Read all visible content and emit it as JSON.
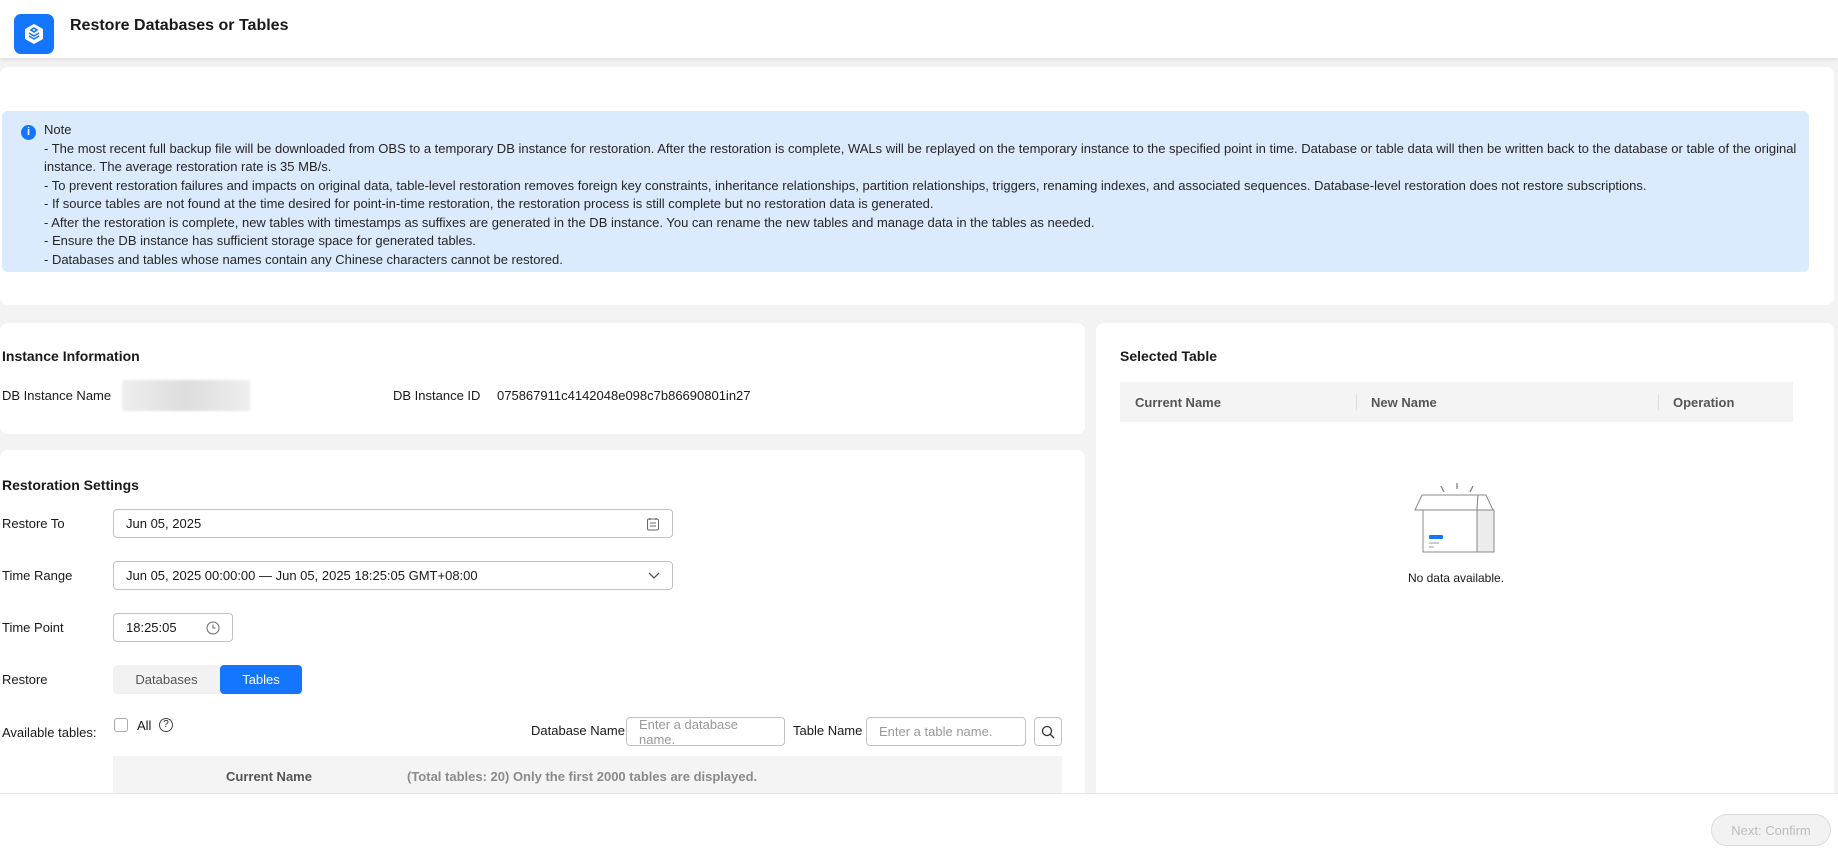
{
  "header": {
    "title": "Restore Databases or Tables"
  },
  "note": {
    "title": "Note",
    "lines": [
      "- The most recent full backup file will be downloaded from OBS to a temporary DB instance for restoration. After the restoration is complete, WALs will be replayed on the temporary instance to the specified point in time. Database or table data will then be written back to the database or table of the original instance. The average restoration rate is 35 MB/s.",
      "- To prevent restoration failures and impacts on original data, table-level restoration removes foreign key constraints, inheritance relationships, partition relationships, triggers, renaming indexes, and associated sequences. Database-level restoration does not restore subscriptions.",
      "- If source tables are not found at the time desired for point-in-time restoration, the restoration process is still complete but no restoration data is generated.",
      "- After the restoration is complete, new tables with timestamps as suffixes are generated in the DB instance. You can rename the new tables and manage data in the tables as needed.",
      "- Ensure the DB instance has sufficient storage space for generated tables.",
      "- Databases and tables whose names contain any Chinese characters cannot be restored."
    ]
  },
  "instance": {
    "title": "Instance Information",
    "name_label": "DB Instance Name",
    "id_label": "DB Instance ID",
    "id_value": "075867911c4142048e098c7b86690801in27"
  },
  "settings": {
    "title": "Restoration Settings",
    "restore_to_label": "Restore To",
    "restore_to_value": "Jun 05, 2025",
    "time_range_label": "Time Range",
    "time_range_value": "Jun 05, 2025 00:00:00 — Jun 05, 2025 18:25:05 GMT+08:00",
    "time_point_label": "Time Point",
    "time_point_value": "18:25:05",
    "restore_label": "Restore",
    "restore_options": [
      "Databases",
      "Tables"
    ],
    "restore_selected": "Tables",
    "available_label": "Available tables:",
    "all_label": "All",
    "db_name_label": "Database Name",
    "db_name_placeholder": "Enter a database name.",
    "table_name_label": "Table Name",
    "table_name_placeholder": "Enter a table name.",
    "table_header": "Current Name",
    "table_info": "(Total tables: 20) Only the first 2000 tables are displayed."
  },
  "selected": {
    "title": "Selected Table",
    "columns": [
      "Current Name",
      "New Name",
      "Operation"
    ],
    "empty": "No data available."
  },
  "footer": {
    "next_label": "Next: Confirm"
  },
  "colors": {
    "accent": "#1476ff",
    "note_bg": "#dbeafd"
  }
}
